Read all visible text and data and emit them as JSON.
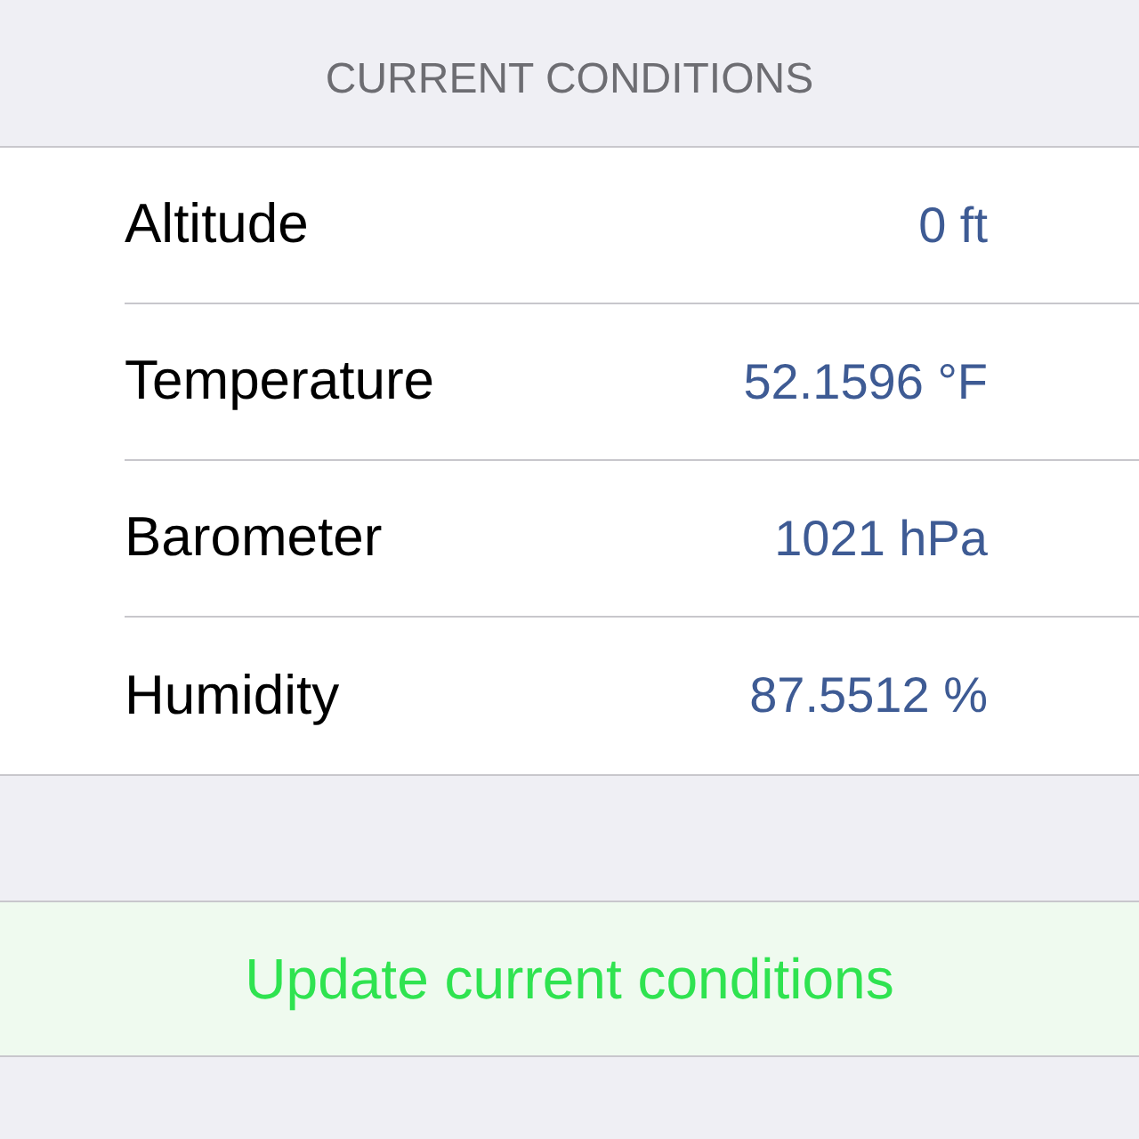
{
  "section_header": "CURRENT CONDITIONS",
  "rows": [
    {
      "label": "Altitude",
      "value": "0 ft"
    },
    {
      "label": "Temperature",
      "value": "52.1596 °F"
    },
    {
      "label": "Barometer",
      "value": "1021 hPa"
    },
    {
      "label": "Humidity",
      "value": "87.5512 %"
    }
  ],
  "action_button": "Update current conditions"
}
